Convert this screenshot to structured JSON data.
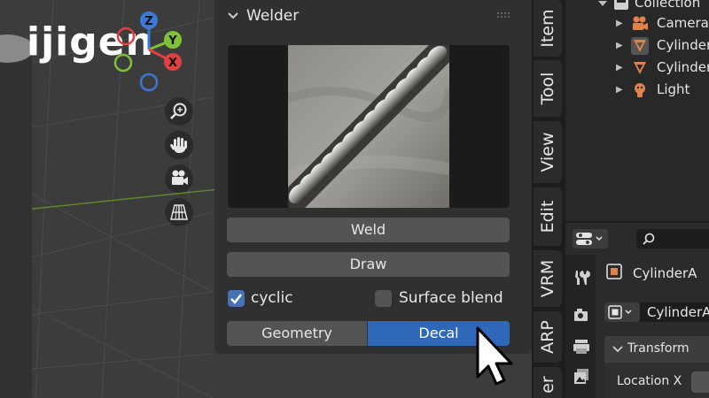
{
  "logo": {
    "text": "ijigen"
  },
  "gizmo": {
    "z_label": "Z",
    "y_label": "Y",
    "x_label": "X"
  },
  "viewport_tools": [
    {
      "name": "zoom-icon"
    },
    {
      "name": "hand-pan-icon"
    },
    {
      "name": "camera-icon"
    },
    {
      "name": "perspective-grid-icon"
    }
  ],
  "panel": {
    "title": "Welder",
    "weld_label": "Weld",
    "draw_label": "Draw",
    "cyclic_label": "cyclic",
    "cyclic_checked": true,
    "surface_blend_label": "Surface blend",
    "surface_blend_checked": false,
    "tabs": {
      "geometry": "Geometry",
      "decal": "Decal",
      "active": "Decal"
    }
  },
  "side_tabs": [
    "Item",
    "Tool",
    "View",
    "Edit",
    "VRM",
    "ARP",
    "er"
  ],
  "outliner": {
    "collection": "Collection",
    "items": [
      {
        "label": "Camera",
        "icon": "camera-object-icon",
        "color": "#e0834a"
      },
      {
        "label": "CylinderA",
        "icon": "mesh-object-icon",
        "color": "#e0834a"
      },
      {
        "label": "CylinderB",
        "icon": "mesh-object-icon",
        "color": "#e0834a"
      },
      {
        "label": "Light",
        "icon": "light-object-icon",
        "color": "#e0834a"
      }
    ]
  },
  "properties": {
    "object_name": "CylinderA",
    "data_name": "CylinderA",
    "transform_label": "Transform",
    "location_x_label": "Location X"
  },
  "colors": {
    "accent": "#4772b3",
    "active_tab": "#2f67b9",
    "object_orange": "#e0834a"
  }
}
